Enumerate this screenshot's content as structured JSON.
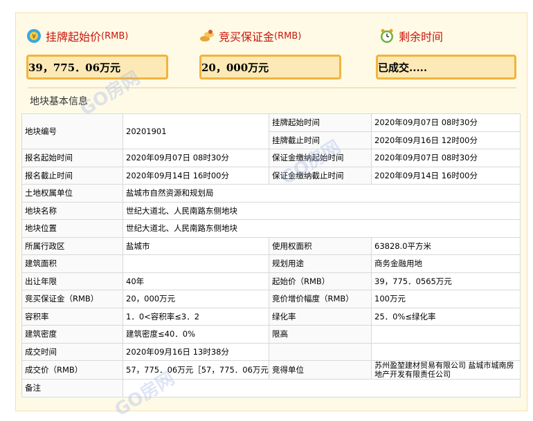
{
  "headers": {
    "start_price": {
      "label": "挂牌起始价",
      "unit": "(RMB)",
      "value": "39，775．06万元"
    },
    "deposit": {
      "label": "竞买保证金",
      "unit": "(RMB)",
      "value": "20，000万元"
    },
    "remaining": {
      "label": "剩余时间",
      "value": "已成交....."
    }
  },
  "section_title": "地块基本信息",
  "watermark": "GO房网",
  "rows": [
    {
      "a": "地块编号",
      "b": "20201901",
      "c": "挂牌起始时间",
      "d": "2020年09月07日 08时30分"
    },
    {
      "c": "挂牌截止时间",
      "d": "2020年09月16日 12时00分"
    },
    {
      "a": "报名起始时间",
      "b": "2020年09月07日 08时30分",
      "c": "保证金缴纳起始时间",
      "d": "2020年09月07日 08时30分"
    },
    {
      "a": "报名截止时间",
      "b": "2020年09月14日 16时00分",
      "c": "保证金缴纳截止时间",
      "d": "2020年09月14日 16时00分"
    },
    {
      "a": "土地权属单位",
      "b": "盐城市自然资源和规划局"
    },
    {
      "a": "地块名称",
      "b": "世纪大道北、人民南路东侧地块"
    },
    {
      "a": "地块位置",
      "b": "世纪大道北、人民南路东侧地块"
    },
    {
      "a": "所属行政区",
      "b": "盐城市",
      "c": "使用权面积",
      "d": "63828.0平方米"
    },
    {
      "a": "建筑面积",
      "b": "",
      "c": "规划用途",
      "d": "商务金融用地"
    },
    {
      "a": "出让年限",
      "b": "40年",
      "c": "起始价（RMB）",
      "d": "39，775．0565万元"
    },
    {
      "a": "竞买保证金（RMB）",
      "b": "20，000万元",
      "c": "竞价增价幅度（RMB）",
      "d": "100万元"
    },
    {
      "a": "容积率",
      "b": "1．0<容积率≤3．2",
      "c": "绿化率",
      "d": "25．0%≤绿化率"
    },
    {
      "a": "建筑密度",
      "b": "建筑密度≤40．0%",
      "c": "限高",
      "d": ""
    },
    {
      "a": "成交时间",
      "b": "2020年09月16日 13时38分",
      "c": "",
      "d": ""
    },
    {
      "a": "成交价（RMB）",
      "b": "57，775．06万元［57，775．06万元］",
      "c": "竞得单位",
      "d": "苏州盈堃建材贸易有限公司 盐城市城南房地产开发有限责任公司"
    },
    {
      "a": "备注",
      "b": ""
    }
  ]
}
